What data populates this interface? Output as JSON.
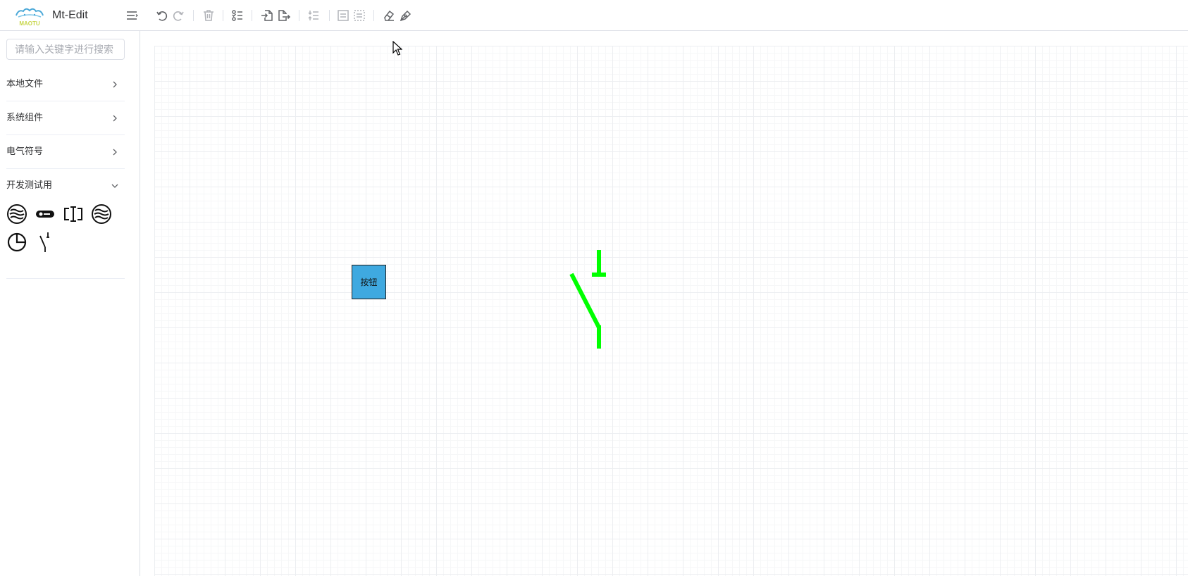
{
  "header": {
    "app_title": "Mt-Edit",
    "logo_text": "MAOTU",
    "toolbar": [
      "menu-icon",
      "undo-icon",
      "redo-icon",
      "delete-icon",
      "layers-icon",
      "import-icon",
      "export-icon",
      "align-icon",
      "group-icon",
      "ungroup-icon",
      "eraser-icon",
      "pen-icon"
    ]
  },
  "sidebar": {
    "search": {
      "placeholder": "请输入关键字进行搜索",
      "value": ""
    },
    "categories": [
      {
        "label": "本地文件",
        "expanded": false
      },
      {
        "label": "系统组件",
        "expanded": false
      },
      {
        "label": "电气符号",
        "expanded": false
      },
      {
        "label": "开发测试用",
        "expanded": true
      }
    ],
    "components": [
      "wave-circle-icon",
      "pill-switch-icon",
      "bracket-icon",
      "wave-circle-icon",
      "pie-clock-icon",
      "switch-symbol-icon"
    ]
  },
  "canvas": {
    "nodes": [
      {
        "type": "button",
        "label": "按钮",
        "color": "#3fa9e0"
      },
      {
        "type": "switch",
        "color": "#00ff00"
      }
    ]
  },
  "colors": {
    "accent_blue": "#3fa9e0",
    "switch_green": "#00ff00",
    "border": "#dcdfe6"
  }
}
